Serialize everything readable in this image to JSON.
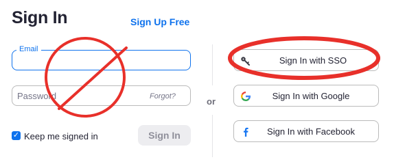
{
  "title": "Sign In",
  "signup_link": "Sign Up Free",
  "email": {
    "label": "Email",
    "value": ""
  },
  "password": {
    "placeholder": "Password",
    "forgot": "Forgot?"
  },
  "keep_signed_in": {
    "label": "Keep me signed in",
    "checked": true
  },
  "signin_button": "Sign In",
  "or_label": "or",
  "alt_signin": [
    {
      "label": "Sign In with SSO",
      "icon": "key-icon"
    },
    {
      "label": "Sign In with Google",
      "icon": "google-icon"
    },
    {
      "label": "Sign In with Facebook",
      "icon": "facebook-icon"
    }
  ],
  "colors": {
    "accent": "#0e72ed",
    "annotation": "#e8302a",
    "facebook": "#1877f2"
  }
}
